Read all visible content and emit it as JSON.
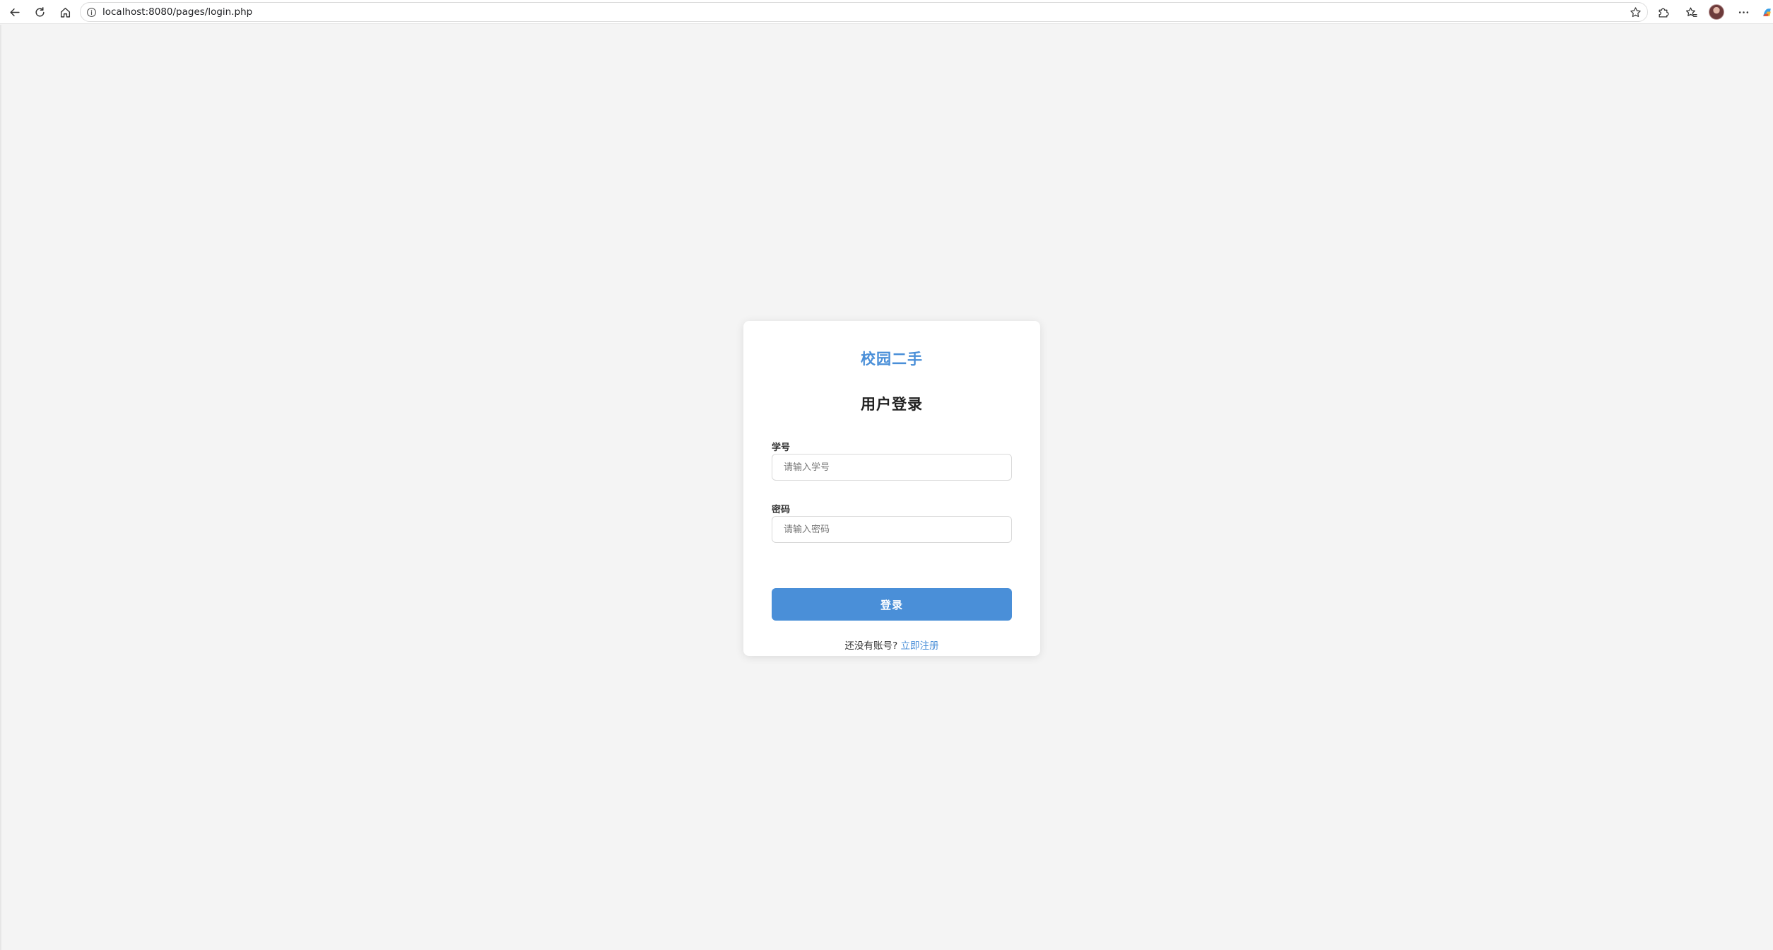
{
  "browser": {
    "url": "localhost:8080/pages/login.php",
    "icons": {
      "back": "arrow-left-icon",
      "reload": "reload-icon",
      "home": "home-icon",
      "site_info": "info-circle-icon",
      "bookmark": "star-icon",
      "extensions": "puzzle-icon",
      "favorites": "favorites-icon",
      "more": "more-dots-icon",
      "copilot": "copilot-icon"
    }
  },
  "login": {
    "brand": "校园二手",
    "title": "用户登录",
    "student_id_label": "学号",
    "student_id_placeholder": "请输入学号",
    "password_label": "密码",
    "password_placeholder": "请输入密码",
    "submit_label": "登录",
    "register_prompt": "还没有账号?",
    "register_link": "立即注册"
  },
  "colors": {
    "accent": "#4a8fd8",
    "page_background": "#f4f4f4",
    "card_background": "#ffffff",
    "text_dark": "#222222"
  }
}
